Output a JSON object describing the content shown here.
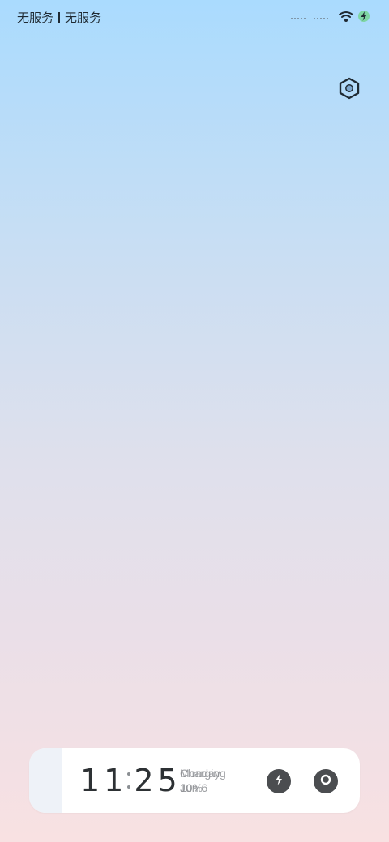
{
  "status_bar": {
    "carrier_1": "无服务",
    "carrier_2": "无服务",
    "icons": [
      "wifi-icon",
      "battery-charging-icon"
    ]
  },
  "settings": {
    "icon": "settings-hexagon-icon"
  },
  "widget": {
    "time_hours": "11",
    "time_minutes": "25",
    "line1_a": "Monday",
    "line1_b": "Charging",
    "line2_a": "10%",
    "line2_b": "Jun 6",
    "charge_level_percent": 10,
    "buttons": [
      "quick-charge-icon",
      "circle-icon"
    ]
  },
  "colors": {
    "gradient_top": "#aadbfe",
    "gradient_bottom": "#f8e1e2",
    "widget_bg": "#ffffff",
    "button_bg": "#4b4d50"
  }
}
